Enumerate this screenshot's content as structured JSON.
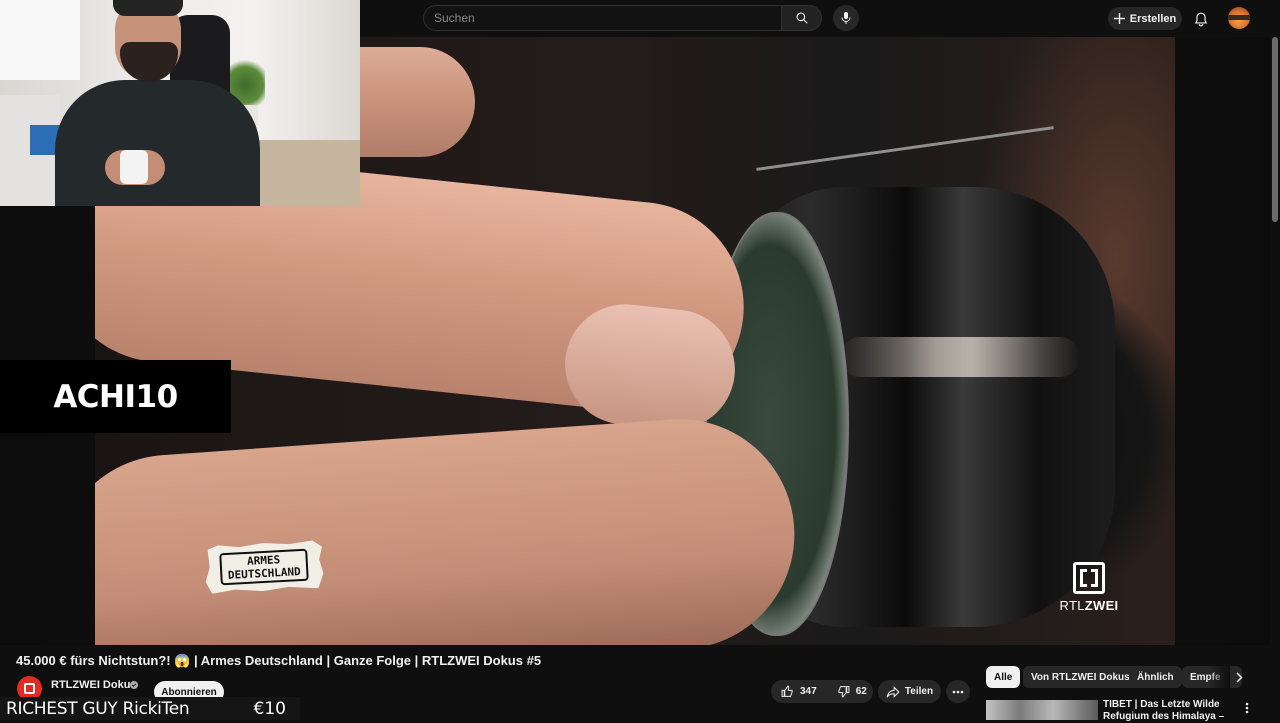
{
  "header": {
    "search": {
      "placeholder": "Suchen"
    },
    "create_label": "Erstellen",
    "icons": {
      "search": "search-icon",
      "mic": "mic-icon",
      "plus": "plus-icon",
      "bell": "bell-icon"
    }
  },
  "video": {
    "overlay_show_logo": "ARMES\nDEUTSCHLAND",
    "overlay_show_logo_line1": "ARMES",
    "overlay_show_logo_line2": "DEUTSCHLAND",
    "broadcaster_logo": {
      "prefix": "RTL",
      "suffix": "ZWEI"
    }
  },
  "stream_overlay": {
    "streamer_tag": "ACHI10",
    "donation_name": "RICHEST GUY RickiTen",
    "donation_amount": "€10"
  },
  "watch": {
    "title": "45.000 € fürs Nichtstun?! 😱 | Armes Deutschland | Ganze Folge | RTLZWEI Dokus #5",
    "channel_name": "RTLZWEI Dokus",
    "subscribe_label": "Abonnieren",
    "likes": "347",
    "dislikes": "62",
    "share_label": "Teilen"
  },
  "chips": [
    "Alle",
    "Von RTLZWEI Dokus",
    "Ähnlich",
    "Empfe"
  ],
  "recommendation": {
    "title": "TIBET | Das Letzte Wilde Refugium des Himalaya –"
  },
  "colors": {
    "background": "#0f0f0f",
    "pill": "#272727",
    "channel_red": "#e12b23"
  }
}
